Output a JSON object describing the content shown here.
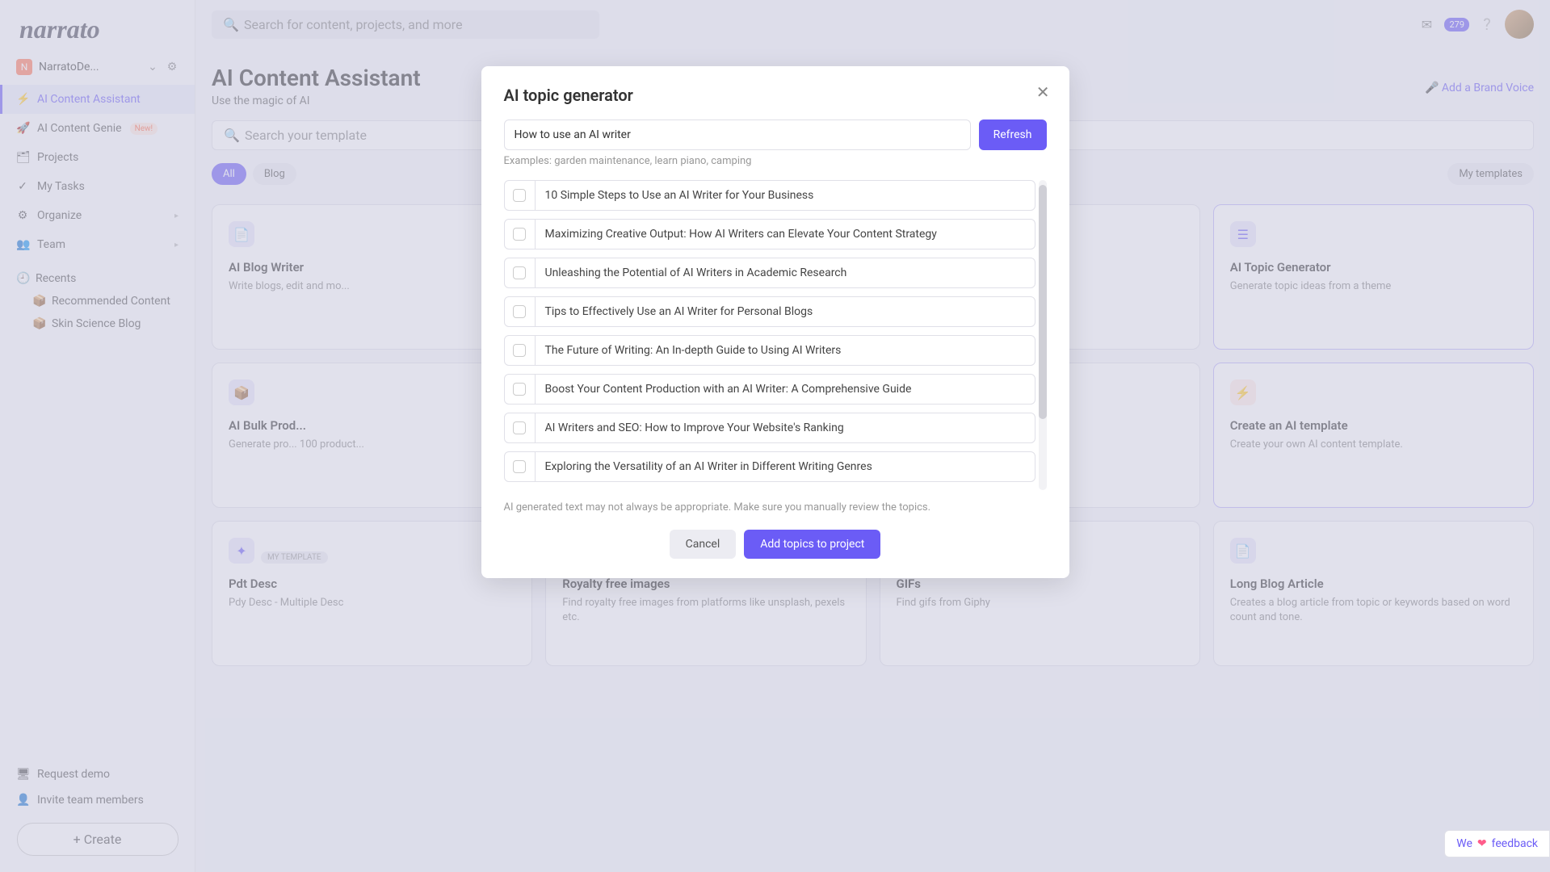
{
  "logo": "narrato",
  "workspace": {
    "badge": "N",
    "name": "NarratoDe..."
  },
  "nav": {
    "ai_assistant": "AI Content Assistant",
    "ai_genie": "AI Content Genie",
    "genie_badge": "New!",
    "projects": "Projects",
    "my_tasks": "My Tasks",
    "organize": "Organize",
    "team": "Team"
  },
  "recents": {
    "header": "Recents",
    "items": [
      "Recommended Content",
      "Skin Science Blog"
    ]
  },
  "footer": {
    "request_demo": "Request demo",
    "invite": "Invite team members",
    "create": "Create"
  },
  "topbar": {
    "search_placeholder": "Search for content, projects, and more",
    "noti_count": "279"
  },
  "page": {
    "title": "AI Content Assistant",
    "subtitle": "Use the magic of AI",
    "brand_voice": "Add a Brand Voice",
    "secondary_search": "Search your template"
  },
  "chips": [
    "All",
    "Blog",
    "My templates"
  ],
  "cards": [
    {
      "title": "AI Blog Writer",
      "desc": "Write blogs, edit and mo...",
      "icon_bg": "#e8e6fb",
      "icon_color": "#6b5cf6",
      "glyph": "📄"
    },
    {
      "title": "",
      "desc": "",
      "icon_bg": "#fff",
      "icon_color": "#fff",
      "glyph": ""
    },
    {
      "title": "",
      "desc": "",
      "icon_bg": "#fff",
      "icon_color": "#fff",
      "glyph": ""
    },
    {
      "title": "AI Topic Generator",
      "desc": "Generate topic ideas from a theme",
      "icon_bg": "#e8e6fb",
      "icon_color": "#6b5cf6",
      "glyph": "☰",
      "highlight": true
    },
    {
      "title": "AI Bulk Prod...",
      "desc": "Generate pro... 100 product...",
      "icon_bg": "#e8e6fb",
      "icon_color": "#6b5cf6",
      "glyph": "📦"
    },
    {
      "title": "",
      "desc": "",
      "icon_bg": "#fff",
      "icon_color": "#fff",
      "glyph": ""
    },
    {
      "title": "",
      "desc": "",
      "icon_bg": "#fff",
      "icon_color": "#fff",
      "glyph": ""
    },
    {
      "title": "Create an AI template",
      "desc": "Create your own AI content template.",
      "icon_bg": "#ffece6",
      "icon_color": "#ff7b5c",
      "glyph": "⚡",
      "highlight": true
    },
    {
      "title": "Pdt Desc",
      "desc": "Pdy Desc - Multiple Desc",
      "icon_bg": "#e8e6fb",
      "icon_color": "#6b5cf6",
      "glyph": "✦",
      "my_template": true
    },
    {
      "title": "Royalty free images",
      "desc": "Find royalty free images from platforms like unsplash, pexels etc.",
      "icon_bg": "#e6f4ea",
      "icon_color": "#4caf50",
      "glyph": "🖼"
    },
    {
      "title": "GIFs",
      "desc": "Find gifs from Giphy",
      "icon_bg": "#fde8ef",
      "icon_color": "#e91e63",
      "glyph": "▶"
    },
    {
      "title": "Long Blog Article",
      "desc": "Creates a blog article from topic or keywords based on word count and tone.",
      "icon_bg": "#e8e6fb",
      "icon_color": "#6b5cf6",
      "glyph": "📄"
    }
  ],
  "my_template_label": "MY TEMPLATE",
  "modal": {
    "title": "AI topic generator",
    "input_value": "How to use an AI writer",
    "refresh": "Refresh",
    "examples": "Examples: garden maintenance, learn piano, camping",
    "topics": [
      "10 Simple Steps to Use an AI Writer for Your Business",
      "Maximizing Creative Output: How AI Writers can Elevate Your Content Strategy",
      "Unleashing the Potential of AI Writers in Academic Research",
      "Tips to Effectively Use an AI Writer for Personal Blogs",
      "The Future of Writing: An In-depth Guide to Using AI Writers",
      "Boost Your Content Production with an AI Writer: A Comprehensive Guide",
      "AI Writers and SEO: How to Improve Your Website's Ranking",
      "Exploring the Versatility of an AI Writer in Different Writing Genres"
    ],
    "disclaimer": "AI generated text may not always be appropriate. Make sure you manually review the topics.",
    "cancel": "Cancel",
    "submit": "Add topics to project"
  },
  "feedback": {
    "we": "We",
    "heart": "❤",
    "text": "feedback"
  }
}
